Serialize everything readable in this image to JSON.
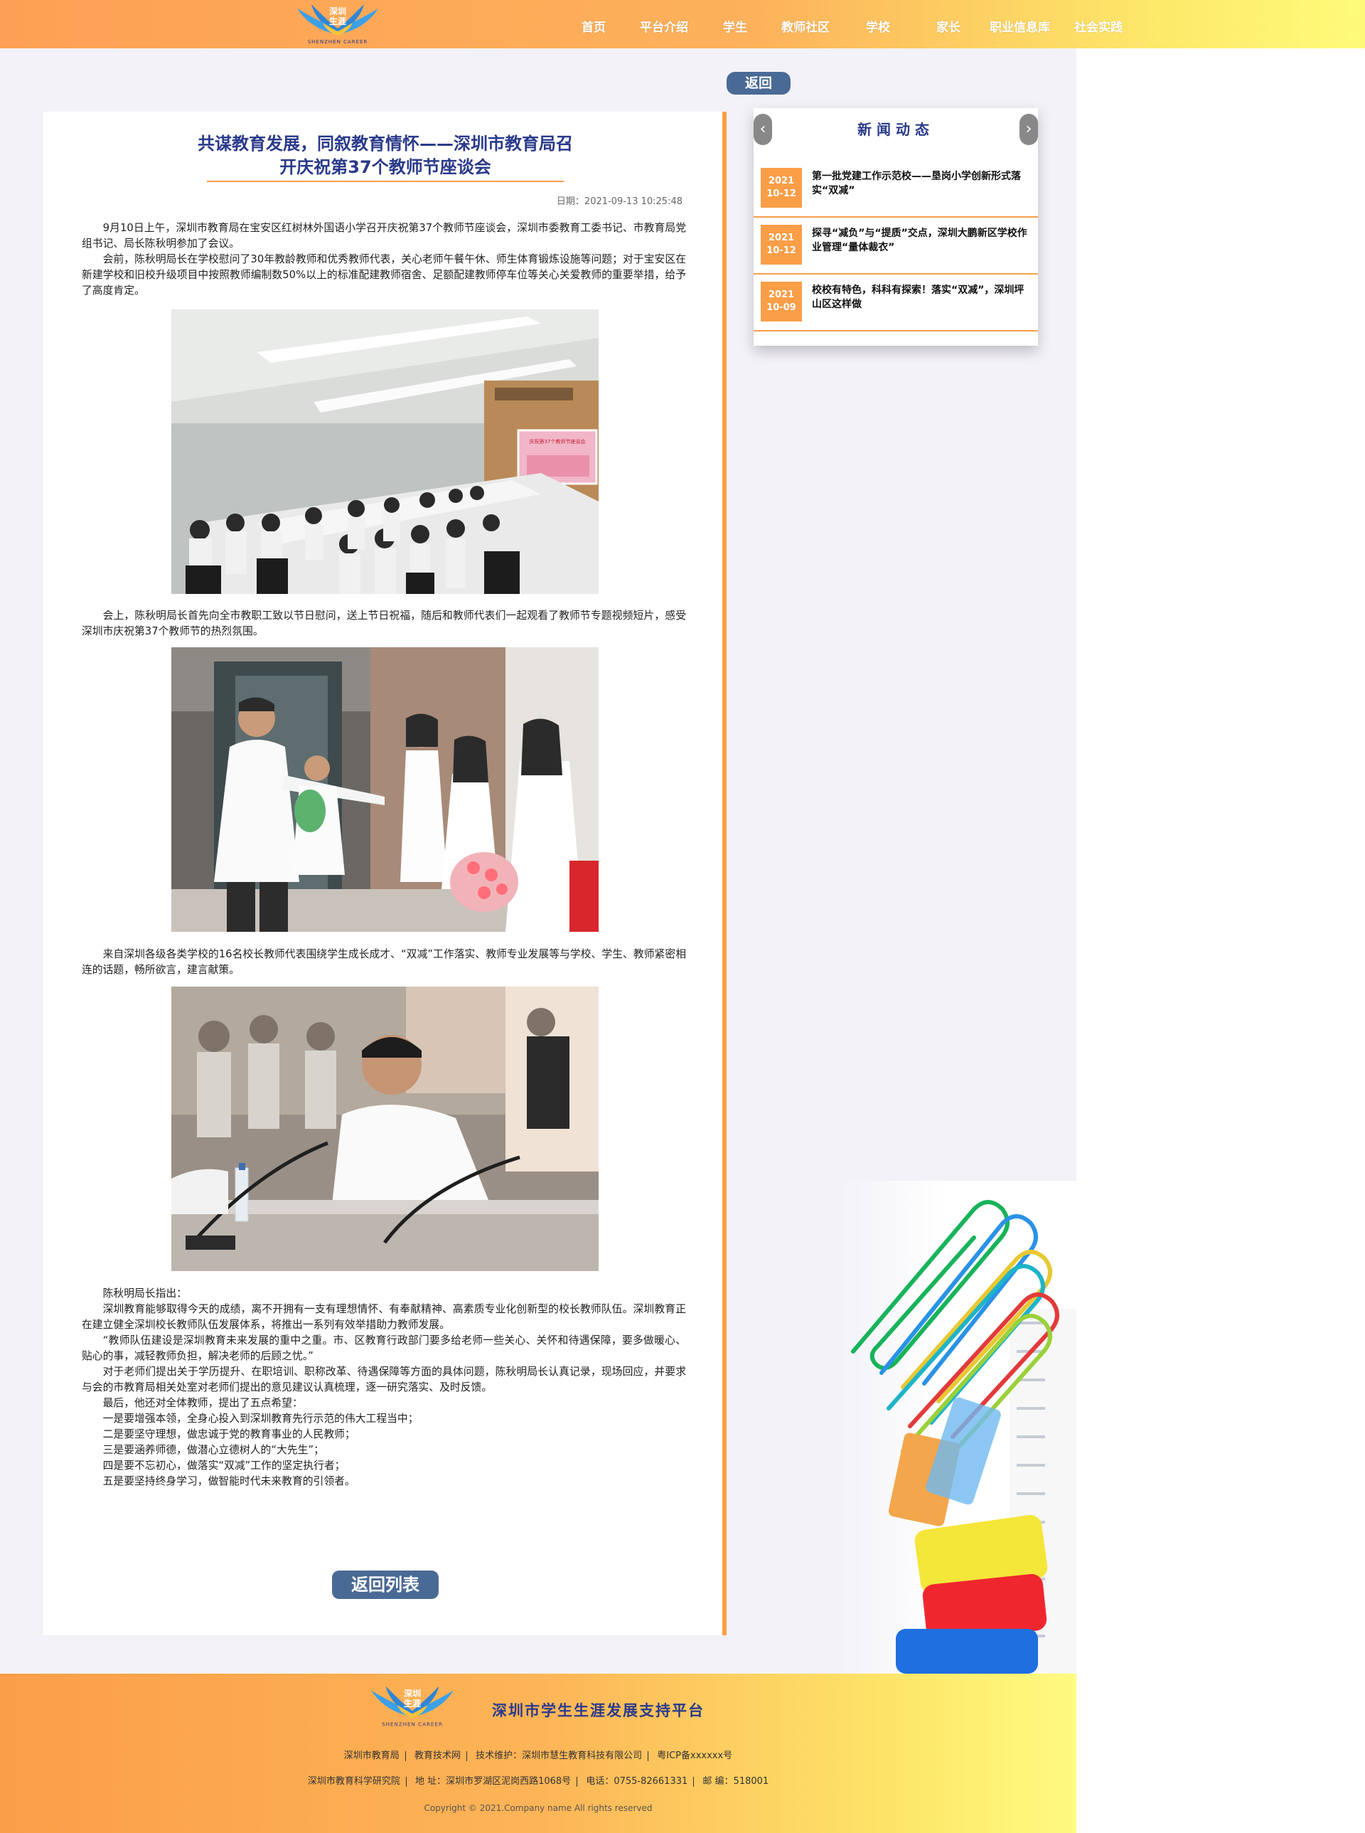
{
  "header": {
    "logo_text_line1": "深圳",
    "logo_text_line2": "生涯",
    "logo_sub": "SHENZHEN CAREER",
    "nav": [
      "首页",
      "平台介绍",
      "学生",
      "教师社区",
      "学校",
      "家长",
      "职业信息库",
      "社会实践"
    ]
  },
  "back_button": "返回",
  "article": {
    "title_line1": "共谋教育发展，同叙教育情怀——深圳市教育局召",
    "title_line2": "开庆祝第37个教师节座谈会",
    "date": "日期：2021-09-13 10:25:48",
    "p1": [
      "9月10日上午，深圳市教育局在宝安区红树林外国语小学召开庆祝第37个教师节座谈会，深圳市委教育工委书记、市教育局党组书记、局长陈秋明参加了会议。",
      "会前，陈秋明局长在学校慰问了30年教龄教师和优秀教师代表，关心老师午餐午休、师生体育锻炼设施等问题；对于宝安区在新建学校和旧校升级项目中按照教师编制数50%以上的标准配建教师宿舍、足额配建教师停车位等关心关爱教师的重要举措，给予了高度肯定。"
    ],
    "p2": [
      "会上，陈秋明局长首先向全市教职工致以节日慰问，送上节日祝福，随后和教师代表们一起观看了教师节专题视频短片，感受深圳市庆祝第37个教师节的热烈氛围。"
    ],
    "p3": [
      "来自深圳各级各类学校的16名校长教师代表围绕学生成长成才、“双减”工作落实、教师专业发展等与学校、学生、教师紧密相连的话题，畅所欲言，建言献策。"
    ],
    "p4": [
      "陈秋明局长指出：",
      "深圳教育能够取得今天的成绩，离不开拥有一支有理想情怀、有奉献精神、高素质专业化创新型的校长教师队伍。深圳教育正在建立健全深圳校长教师队伍发展体系，将推出一系列有效举措助力教师发展。",
      "“教师队伍建设是深圳教育未来发展的重中之重。市、区教育行政部门要多给老师一些关心、关怀和待遇保障，要多做暖心、贴心的事，减轻教师负担，解决老师的后顾之忧。”",
      "对于老师们提出关于学历提升、在职培训、职称改革、待遇保障等方面的具体问题，陈秋明局长认真记录，现场回应，并要求与会的市教育局相关处室对老师们提出的意见建议认真梳理，逐一研究落实、及时反馈。",
      "最后，他还对全体教师，提出了五点希望：",
      "一是要增强本领，全身心投入到深圳教育先行示范的伟大工程当中；",
      "二是要坚守理想，做忠诚于党的教育事业的人民教师；",
      "三是要涵养师德，做潜心立德树人的“大先生”；",
      "四是要不忘初心，做落实“双减”工作的坚定执行者；",
      "五是要坚持终身学习，做智能时代未来教育的引领者。"
    ],
    "screen_text": "庆祝第37个教师节座谈会",
    "return_list": "返回列表"
  },
  "news": {
    "title": "新闻动态",
    "items": [
      {
        "year": "2021",
        "md": "10-12",
        "text": "第一批党建工作示范校——垦岗小学创新形式落实“双减”"
      },
      {
        "year": "2021",
        "md": "10-12",
        "text": "探寻“减负”与“提质”交点，深圳大鹏新区学校作业管理“量体裁衣”"
      },
      {
        "year": "2021",
        "md": "10-09",
        "text": "校校有特色，科科有探索！落实“双减”，深圳坪山区这样做"
      }
    ]
  },
  "footer": {
    "platform_name": "深圳市学生生涯发展支持平台",
    "row1": [
      "深圳市教育局",
      "教育技术网",
      "技术维护：深圳市慧生教育科技有限公司",
      "粤ICP备xxxxxx号"
    ],
    "row2": [
      "深圳市教育科学研究院",
      "地  址：深圳市罗湖区泥岗西路1068号",
      "电话：0755-82661331",
      "邮  编：518001"
    ],
    "copyright": "Copyright © 2021.Company name All rights reserved"
  },
  "colors": {
    "accent": "#fb9e48",
    "navy": "#2a3a8a",
    "button": "#4a6a96"
  }
}
